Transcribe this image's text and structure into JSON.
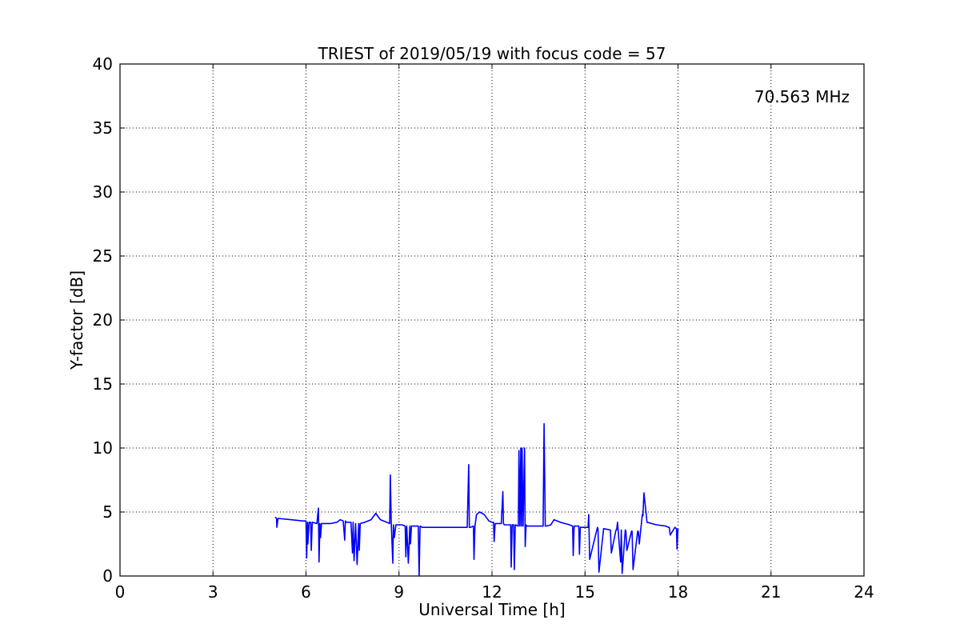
{
  "chart_data": {
    "type": "line",
    "title": "TRIEST of 2019/05/19 with focus code = 57",
    "xlabel": "Universal Time [h]",
    "ylabel": "Y-factor [dB]",
    "xlim": [
      0,
      24
    ],
    "ylim": [
      0,
      40
    ],
    "xticks": [
      0,
      3,
      6,
      9,
      12,
      15,
      18,
      21,
      24
    ],
    "yticks": [
      0,
      5,
      10,
      15,
      20,
      25,
      30,
      35,
      40
    ],
    "grid": true,
    "grid_style": "dotted",
    "annotation": {
      "text": "70.563 MHz",
      "color": "#0000ff",
      "placement": "top-right"
    },
    "series": [
      {
        "color": "#0000ff",
        "x": [
          5.0,
          5.05,
          5.06,
          5.1,
          5.5,
          5.9,
          6.0,
          6.02,
          6.05,
          6.06,
          6.1,
          6.15,
          6.17,
          6.2,
          6.35,
          6.4,
          6.42,
          6.45,
          6.47,
          6.5,
          6.8,
          7.0,
          7.1,
          7.2,
          7.25,
          7.27,
          7.3,
          7.45,
          7.5,
          7.52,
          7.55,
          7.6,
          7.65,
          7.7,
          7.72,
          7.75,
          7.9,
          8.1,
          8.25,
          8.4,
          8.6,
          8.7,
          8.72,
          8.75,
          8.8,
          8.82,
          8.85,
          8.9,
          9.1,
          9.2,
          9.22,
          9.25,
          9.3,
          9.35,
          9.37,
          9.4,
          9.5,
          9.62,
          9.65,
          9.68,
          9.75,
          10.0,
          10.5,
          11.0,
          11.2,
          11.25,
          11.27,
          11.3,
          11.4,
          11.42,
          11.45,
          11.5,
          11.6,
          11.75,
          11.9,
          12.0,
          12.05,
          12.07,
          12.1,
          12.3,
          12.35,
          12.37,
          12.4,
          12.5,
          12.6,
          12.62,
          12.65,
          12.7,
          12.72,
          12.75,
          12.85,
          12.87,
          12.9,
          12.93,
          12.95,
          12.97,
          13.0,
          13.05,
          13.07,
          13.1,
          13.12,
          13.15,
          13.5,
          13.65,
          13.68,
          13.72,
          13.75,
          13.9,
          14.0,
          14.2,
          14.5,
          14.6,
          14.62,
          14.65,
          14.8,
          14.82,
          14.85,
          15.0,
          15.1,
          15.12,
          15.15,
          15.4,
          15.42,
          15.45,
          15.6,
          15.8,
          15.82,
          15.85,
          16.0,
          16.02,
          16.05,
          16.15,
          16.17,
          16.2,
          16.3,
          16.32,
          16.35,
          16.5,
          16.52,
          16.55,
          16.7,
          16.72,
          16.75,
          16.85,
          16.87,
          16.9,
          17.0,
          17.3,
          17.6,
          17.7,
          17.72,
          17.75,
          17.9,
          17.95,
          17.97,
          18.0
        ],
        "y": [
          4.6,
          4.5,
          3.8,
          4.5,
          4.4,
          4.3,
          4.3,
          1.4,
          4.2,
          2.5,
          4.2,
          4.2,
          2.0,
          4.2,
          4.1,
          5.3,
          1.1,
          4.1,
          3.0,
          4.1,
          4.1,
          4.2,
          4.4,
          4.3,
          2.8,
          4.3,
          4.2,
          4.2,
          1.8,
          4.2,
          1.2,
          4.1,
          0.9,
          4.1,
          2.0,
          4.1,
          4.2,
          4.4,
          4.9,
          4.4,
          4.2,
          4.1,
          7.9,
          4.1,
          1.0,
          4.0,
          3.0,
          4.0,
          4.0,
          3.9,
          1.5,
          3.9,
          1.0,
          3.9,
          2.5,
          3.9,
          3.9,
          3.9,
          0.0,
          3.9,
          3.8,
          3.8,
          3.8,
          3.8,
          3.8,
          8.7,
          3.8,
          3.8,
          3.9,
          1.3,
          3.9,
          4.8,
          5.0,
          4.8,
          4.3,
          4.2,
          4.2,
          2.7,
          4.1,
          4.1,
          6.6,
          4.1,
          4.0,
          4.0,
          4.0,
          0.7,
          4.0,
          4.0,
          0.5,
          4.0,
          3.9,
          9.8,
          3.9,
          10.0,
          3.9,
          10.0,
          3.9,
          10.0,
          2.3,
          4.0,
          3.9,
          3.9,
          3.9,
          3.9,
          11.9,
          3.9,
          3.9,
          4.0,
          4.4,
          4.2,
          4.0,
          3.9,
          1.6,
          3.9,
          3.9,
          1.7,
          3.8,
          3.8,
          3.8,
          4.8,
          1.3,
          3.8,
          3.7,
          0.3,
          3.7,
          3.6,
          3.6,
          1.8,
          3.6,
          3.6,
          4.2,
          1.1,
          3.6,
          0.2,
          3.6,
          3.5,
          2.0,
          3.5,
          3.5,
          0.5,
          3.5,
          3.5,
          2.5,
          4.8,
          4.7,
          6.5,
          4.2,
          4.0,
          3.9,
          3.8,
          3.8,
          3.2,
          3.8,
          3.7,
          2.1,
          3.7
        ]
      }
    ]
  }
}
